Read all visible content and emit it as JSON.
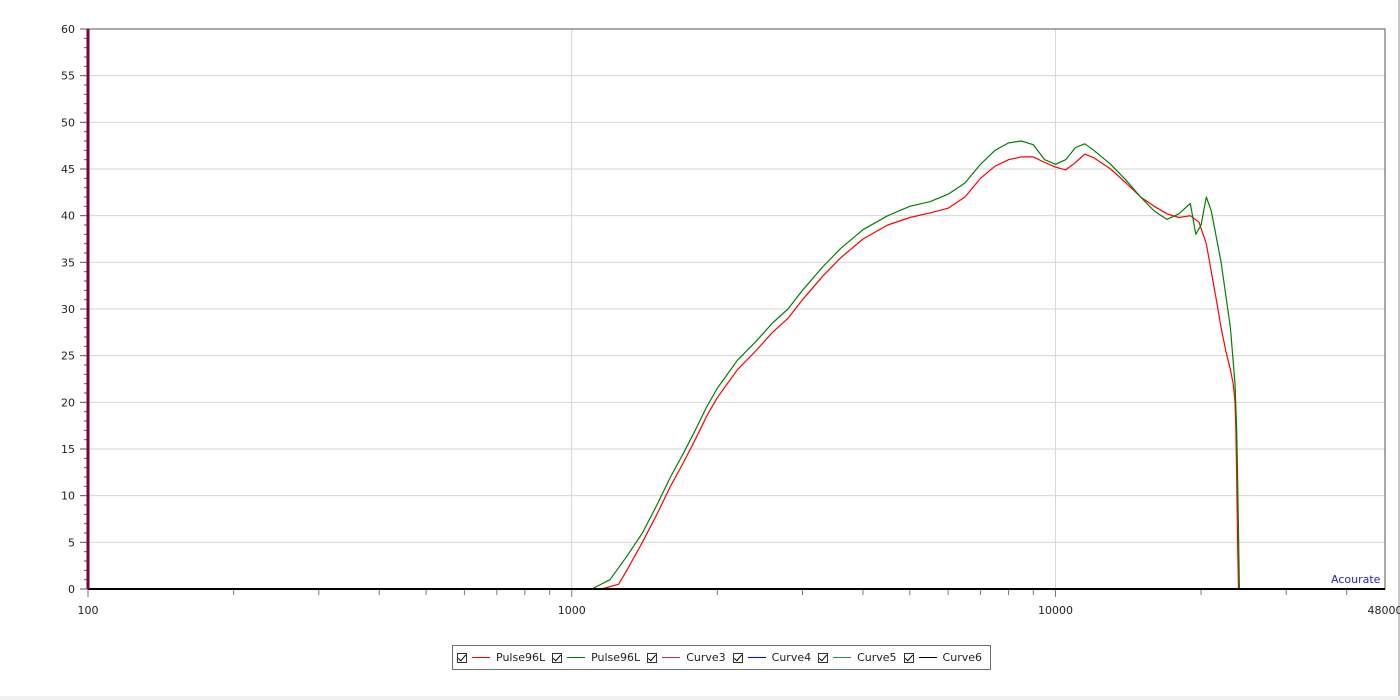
{
  "chart_data": {
    "type": "line",
    "x_scale": "log",
    "xlim": [
      100,
      48000
    ],
    "ylim": [
      0,
      60
    ],
    "x_ticks": [
      {
        "value": 100,
        "label": "100"
      },
      {
        "value": 1000,
        "label": "1000"
      },
      {
        "value": 10000,
        "label": "10000"
      },
      {
        "value": 48000,
        "label": "48000"
      }
    ],
    "y_ticks": [
      0,
      5,
      10,
      15,
      20,
      25,
      30,
      35,
      40,
      45,
      50,
      55,
      60
    ],
    "y_tick_labels": [
      "0",
      "5",
      "10",
      "15",
      "20",
      "25",
      "30",
      "35",
      "40",
      "45",
      "50",
      "55",
      "60"
    ],
    "grid": true,
    "legend_position": "bottom-center",
    "series": [
      {
        "name": "Pulse96L",
        "color": "#ff0000",
        "checked": true,
        "points": [
          [
            100,
            0
          ],
          [
            1000,
            0
          ],
          [
            1150,
            0
          ],
          [
            1250,
            0.5
          ],
          [
            1300,
            2
          ],
          [
            1400,
            5
          ],
          [
            1500,
            8
          ],
          [
            1600,
            11
          ],
          [
            1700,
            13.5
          ],
          [
            1800,
            16
          ],
          [
            1900,
            18.5
          ],
          [
            2000,
            20.5
          ],
          [
            2200,
            23.5
          ],
          [
            2400,
            25.5
          ],
          [
            2600,
            27.5
          ],
          [
            2800,
            29
          ],
          [
            3000,
            31
          ],
          [
            3300,
            33.5
          ],
          [
            3600,
            35.5
          ],
          [
            4000,
            37.5
          ],
          [
            4500,
            39
          ],
          [
            5000,
            39.8
          ],
          [
            5500,
            40.3
          ],
          [
            6000,
            40.8
          ],
          [
            6500,
            42
          ],
          [
            7000,
            44
          ],
          [
            7500,
            45.3
          ],
          [
            8000,
            46
          ],
          [
            8500,
            46.3
          ],
          [
            9000,
            46.3
          ],
          [
            9500,
            45.7
          ],
          [
            10000,
            45.2
          ],
          [
            10500,
            44.9
          ],
          [
            11000,
            45.7
          ],
          [
            11500,
            46.6
          ],
          [
            12000,
            46.2
          ],
          [
            13000,
            45
          ],
          [
            14000,
            43.5
          ],
          [
            15000,
            42
          ],
          [
            16000,
            41
          ],
          [
            17000,
            40.2
          ],
          [
            18000,
            39.8
          ],
          [
            19000,
            40
          ],
          [
            19800,
            39.3
          ],
          [
            20500,
            37
          ],
          [
            21000,
            34
          ],
          [
            21500,
            31
          ],
          [
            22000,
            28
          ],
          [
            22500,
            25.5
          ],
          [
            23000,
            23.5
          ],
          [
            23300,
            22
          ],
          [
            23500,
            20
          ],
          [
            23600,
            17
          ],
          [
            23700,
            12
          ],
          [
            23800,
            5
          ],
          [
            23900,
            0
          ]
        ]
      },
      {
        "name": "Pulse96L",
        "color": "#008000",
        "checked": true,
        "points": [
          [
            100,
            0
          ],
          [
            1000,
            0
          ],
          [
            1100,
            0
          ],
          [
            1200,
            1
          ],
          [
            1300,
            3.5
          ],
          [
            1400,
            6
          ],
          [
            1500,
            9
          ],
          [
            1600,
            12
          ],
          [
            1700,
            14.5
          ],
          [
            1800,
            17
          ],
          [
            1900,
            19.5
          ],
          [
            2000,
            21.5
          ],
          [
            2200,
            24.5
          ],
          [
            2400,
            26.5
          ],
          [
            2600,
            28.5
          ],
          [
            2800,
            30
          ],
          [
            3000,
            32
          ],
          [
            3300,
            34.5
          ],
          [
            3600,
            36.5
          ],
          [
            4000,
            38.5
          ],
          [
            4500,
            40
          ],
          [
            5000,
            41
          ],
          [
            5500,
            41.5
          ],
          [
            6000,
            42.3
          ],
          [
            6500,
            43.5
          ],
          [
            7000,
            45.5
          ],
          [
            7500,
            47
          ],
          [
            8000,
            47.8
          ],
          [
            8500,
            48
          ],
          [
            9000,
            47.6
          ],
          [
            9500,
            46
          ],
          [
            10000,
            45.5
          ],
          [
            10500,
            46
          ],
          [
            11000,
            47.3
          ],
          [
            11500,
            47.7
          ],
          [
            12000,
            47
          ],
          [
            13000,
            45.5
          ],
          [
            14000,
            43.8
          ],
          [
            15000,
            42
          ],
          [
            16000,
            40.5
          ],
          [
            17000,
            39.6
          ],
          [
            18000,
            40.2
          ],
          [
            19000,
            41.3
          ],
          [
            19500,
            38
          ],
          [
            20000,
            39
          ],
          [
            20500,
            42
          ],
          [
            21000,
            40.5
          ],
          [
            22000,
            35
          ],
          [
            23000,
            28
          ],
          [
            23500,
            22
          ],
          [
            23700,
            17
          ],
          [
            23800,
            12
          ],
          [
            23900,
            6
          ],
          [
            24000,
            0
          ]
        ]
      },
      {
        "name": "Curve3",
        "color": "#b03060",
        "checked": true,
        "points": []
      },
      {
        "name": "Curve4",
        "color": "#0000ff",
        "checked": true,
        "points": []
      },
      {
        "name": "Curve5",
        "color": "#2e8b57",
        "checked": true,
        "points": []
      },
      {
        "name": "Curve6",
        "color": "#000000",
        "checked": true,
        "points": []
      }
    ]
  },
  "brand_label": "Acourate",
  "colors": {
    "grid": "#d6d6d6",
    "axis": "#000000",
    "left_marker": "#7b0040"
  }
}
